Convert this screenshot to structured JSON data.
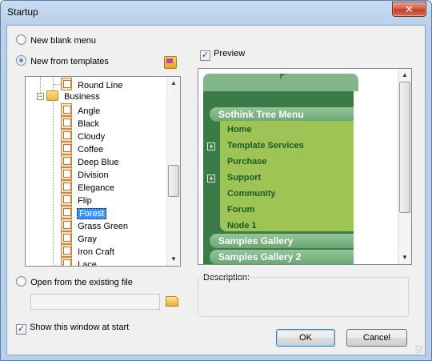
{
  "window": {
    "title": "Startup",
    "close_glyph": "✕"
  },
  "options": {
    "new_blank": {
      "label": "New blank menu",
      "checked": false
    },
    "new_from_templates": {
      "label": "New from templates",
      "checked": true
    },
    "open_existing": {
      "label": "Open from the existing file",
      "checked": false
    },
    "show_at_start": {
      "label": "Show this window at start",
      "checked": true
    }
  },
  "preview": {
    "label": "Preview",
    "checked": true
  },
  "description": {
    "label": "Description:"
  },
  "tree": {
    "items": [
      {
        "label": "Round Line",
        "type": "template",
        "selected": false
      },
      {
        "label": "Business",
        "type": "folder",
        "expanded": true
      },
      {
        "label": "Angle",
        "type": "template",
        "selected": false
      },
      {
        "label": "Black",
        "type": "template",
        "selected": false
      },
      {
        "label": "Cloudy",
        "type": "template",
        "selected": false
      },
      {
        "label": "Coffee",
        "type": "template",
        "selected": false
      },
      {
        "label": "Deep Blue",
        "type": "template",
        "selected": false
      },
      {
        "label": "Division",
        "type": "template",
        "selected": false
      },
      {
        "label": "Elegance",
        "type": "template",
        "selected": false
      },
      {
        "label": "Flip",
        "type": "template",
        "selected": false
      },
      {
        "label": "Forest",
        "type": "template",
        "selected": true
      },
      {
        "label": "Grass Green",
        "type": "template",
        "selected": false
      },
      {
        "label": "Gray",
        "type": "template",
        "selected": false
      },
      {
        "label": "Iron Craft",
        "type": "template",
        "selected": false
      },
      {
        "label": "Lace",
        "type": "template",
        "selected": false
      }
    ]
  },
  "menu_preview": {
    "header": "Sothink Tree Menu",
    "items": [
      {
        "label": "Home",
        "expandable": false
      },
      {
        "label": "Template Services",
        "expandable": true
      },
      {
        "label": "Purchase",
        "expandable": false
      },
      {
        "label": "Support",
        "expandable": true
      },
      {
        "label": "Community",
        "expandable": false
      },
      {
        "label": "Forum",
        "expandable": false
      },
      {
        "label": "Node 1",
        "expandable": false
      }
    ],
    "footers": [
      "Samples Gallery",
      "Samples Gallery  2"
    ],
    "colors": {
      "background": "#3a7b47",
      "submenu": "#9dc454",
      "item_text": "#1e5a25"
    }
  },
  "buttons": {
    "ok": "OK",
    "cancel": "Cancel"
  }
}
